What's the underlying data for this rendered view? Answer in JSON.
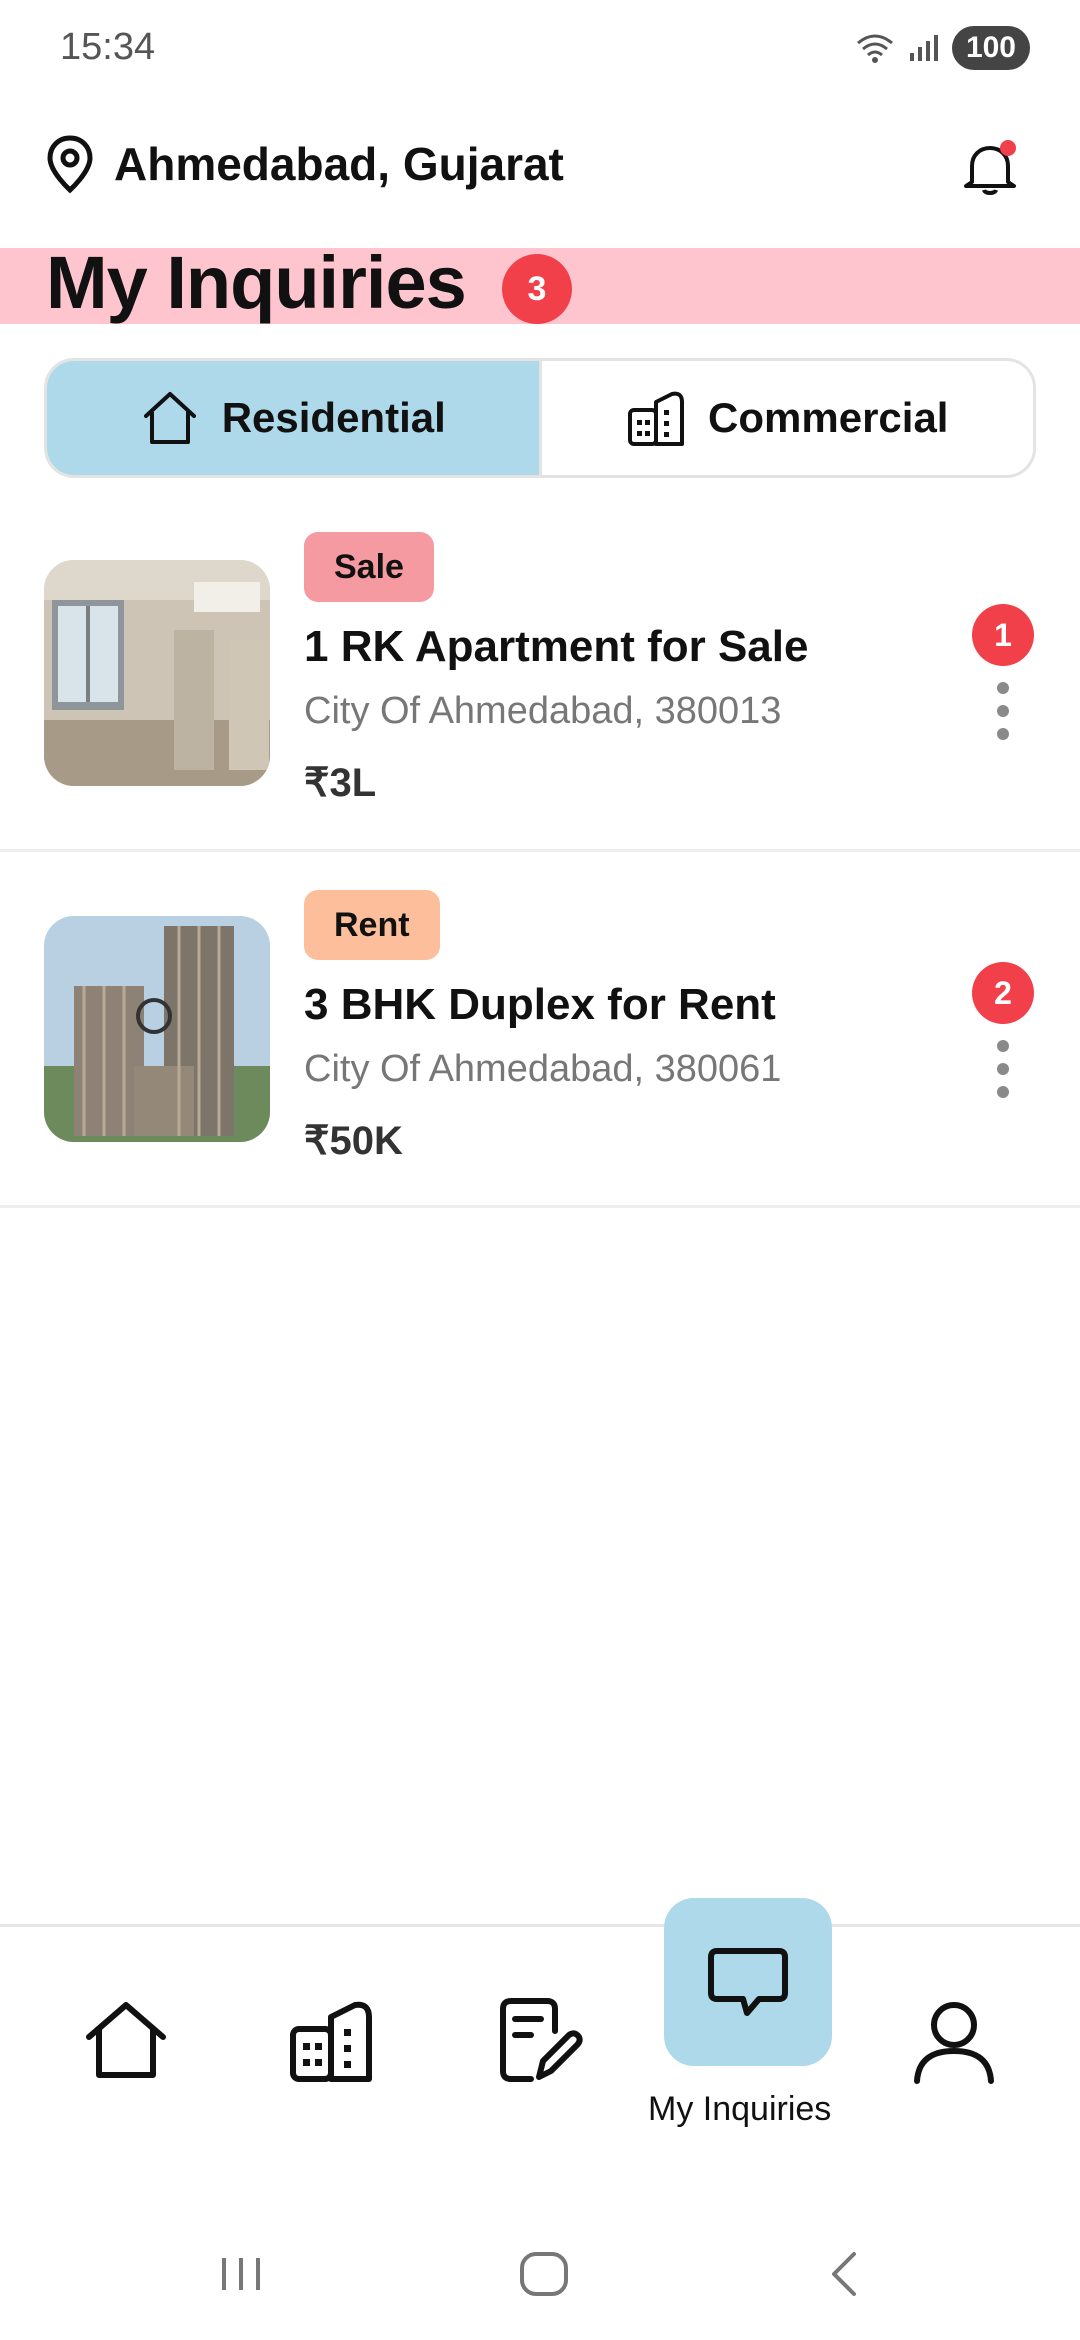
{
  "status_bar": {
    "time": "15:34",
    "battery": "100"
  },
  "location": {
    "text": "Ahmedabad, Gujarat",
    "icon": "location-pin-icon"
  },
  "header": {
    "title": "My Inquiries",
    "count": "3",
    "notification_icon": "bell-icon"
  },
  "tabs": [
    {
      "label": "Residential",
      "active": true,
      "icon": "house-icon"
    },
    {
      "label": "Commercial",
      "active": false,
      "icon": "building-icon"
    }
  ],
  "listings": [
    {
      "tag": "Sale",
      "title": "1 RK Apartment for Sale",
      "address": "City Of Ahmedabad, 380013",
      "price": "₹3L",
      "inquiry_count": "1"
    },
    {
      "tag": "Rent",
      "title": "3 BHK Duplex for Rent",
      "address": "City Of Ahmedabad, 380061",
      "price": "₹50K",
      "inquiry_count": "2"
    }
  ],
  "bottom_nav": {
    "items": [
      {
        "icon": "home-icon"
      },
      {
        "icon": "buildings-icon"
      },
      {
        "icon": "edit-document-icon"
      },
      {
        "icon": "chat-icon",
        "label": "My Inquiries",
        "active": true
      },
      {
        "icon": "profile-icon"
      }
    ]
  },
  "colors": {
    "accent_blue": "#add9ea",
    "badge_red": "#f2404b",
    "title_band": "#ffc5cf",
    "sale_tag": "#f59aa1",
    "rent_tag": "#fdbf9b"
  }
}
